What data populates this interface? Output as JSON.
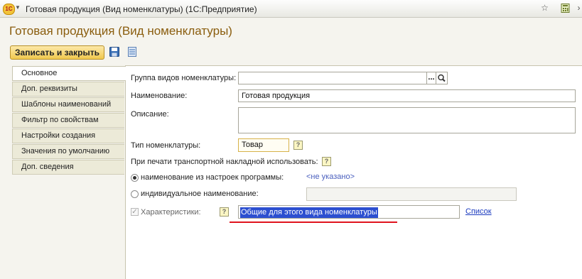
{
  "window": {
    "app_logo": "1С",
    "title": "Готовая продукция (Вид номенклатуры)  (1С:Предприятие)"
  },
  "form": {
    "title": "Готовая продукция (Вид номенклатуры)",
    "save_close_label": "Записать и закрыть"
  },
  "tabs": [
    {
      "label": "Основное"
    },
    {
      "label": "Доп. реквизиты"
    },
    {
      "label": "Шаблоны наименований"
    },
    {
      "label": "Фильтр по свойствам"
    },
    {
      "label": "Настройки создания"
    },
    {
      "label": "Значения по умолчанию"
    },
    {
      "label": "Доп. сведения"
    }
  ],
  "fields": {
    "group_label": "Группа видов номенклатуры:",
    "group_value": "",
    "group_select_button": "...",
    "name_label": "Наименование:",
    "name_value": "Готовая продукция",
    "description_label": "Описание:",
    "description_value": "",
    "type_label": "Тип номенклатуры:",
    "type_value": "Товар",
    "help_mark": "?",
    "transport_label": "При печати транспортной накладной использовать:",
    "radio_settings_label": "наименование из настроек программы:",
    "radio_settings_value": "<не указано>",
    "radio_individual_label": "индивидуальное наименование:",
    "individual_value": "",
    "characteristics_label": "Характеристики:",
    "characteristics_value": "Общие для этого вида номенклатуры",
    "list_link": "Список"
  },
  "icons": {
    "fav": "star-icon",
    "calc": "calculator-icon",
    "more": "chevron-right-icon",
    "save": "floppy-disk-icon",
    "list": "list-icon",
    "search": "magnifier-icon"
  },
  "colors": {
    "title": "#8a5d0e",
    "button_top": "#fde9a9",
    "button_bottom": "#f0c84e",
    "link": "#1b3bbf",
    "selection": "#2c4fd0",
    "annotation_underline": "#e0141e"
  }
}
